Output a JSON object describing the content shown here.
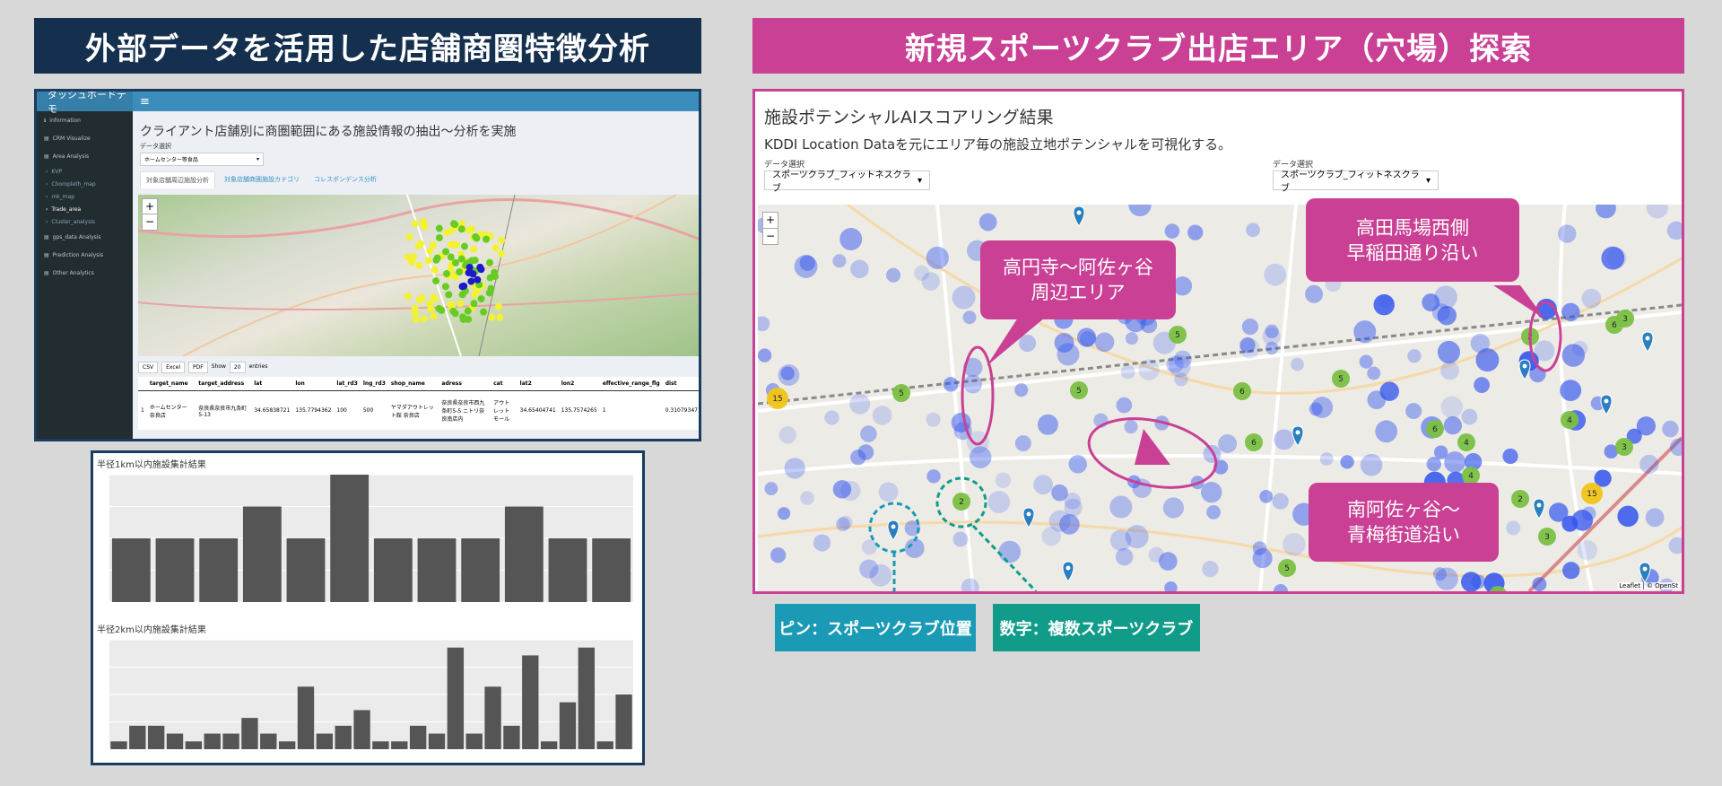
{
  "banners": {
    "left": "外部データを活用した店舗商圏特徴分析",
    "right": "新規スポーツクラブ出店エリア（穴場）探索"
  },
  "dashboard": {
    "brand": "ダッシュボードデモ",
    "menu_icon": "hamburger-icon",
    "sidebar": [
      {
        "label": "information",
        "icon": "info-icon",
        "type": "item"
      },
      {
        "label": "CRM Visualize",
        "icon": "chart-icon",
        "type": "item"
      },
      {
        "label": "Area Analysis",
        "icon": "chart-icon",
        "type": "item"
      },
      {
        "label": "KVP",
        "type": "sub"
      },
      {
        "label": "Choropleth_map",
        "type": "sub"
      },
      {
        "label": "mk_map",
        "type": "sub"
      },
      {
        "label": "Trade_area",
        "type": "sub",
        "active": true
      },
      {
        "label": "Cluster_analysis",
        "type": "sub"
      },
      {
        "label": "gps_data Analysis",
        "icon": "chart-icon",
        "type": "item"
      },
      {
        "label": "Prediction Analysis",
        "icon": "chart-icon",
        "type": "item"
      },
      {
        "label": "Other Analytics",
        "icon": "chart-icon",
        "type": "item"
      }
    ],
    "heading": "クライアント店舗別に商圏範囲にある施設情報の抽出～分析を実施",
    "data_label": "データ選択",
    "select_value": "ホームセンター等食品",
    "tabs": [
      "対象店舗周辺施設分析",
      "対象店舗商圏施設カテゴリ",
      "コレスポンデンス分析"
    ],
    "table_buttons": [
      "CSV",
      "Excel",
      "PDF"
    ],
    "show_label": "Show",
    "show_value": "20",
    "entries_label": "entries",
    "columns": [
      "",
      "target_name",
      "target_address",
      "lat",
      "lon",
      "lat_rd3",
      "lng_rd3",
      "shop_name",
      "adress",
      "cat",
      "lat2",
      "lon2",
      "effective_range_flg",
      "dist"
    ],
    "row": [
      "1",
      "ホームセンター 奈良店",
      "奈良県奈良市九条町5-13",
      "34.65838721",
      "135.7794362",
      "100",
      "500",
      "ヤマダアウトレット館 奈良店",
      "奈良県奈良市西九条町5-5 ニトリ奈良南店内",
      "アウトレットモール",
      "34.65404741",
      "135.7574265",
      "1",
      "0.31079347"
    ]
  },
  "charts": {
    "chart1": {
      "title": "半径1km以内施設集計結果",
      "values": [
        2,
        2,
        2,
        3,
        2,
        4,
        2,
        2,
        2,
        3,
        2,
        2
      ],
      "ylim": [
        0,
        4
      ]
    },
    "chart2": {
      "title": "半径2km以内施設集計結果",
      "values": [
        1,
        3,
        3,
        2,
        1,
        2,
        2,
        4,
        2,
        1,
        8,
        2,
        3,
        5,
        1,
        1,
        3,
        2,
        13,
        2,
        8,
        3,
        12,
        1,
        6,
        13,
        1,
        7
      ],
      "ylim": [
        0,
        14
      ]
    }
  },
  "map_panel": {
    "title": "施設ポテンシャルAIスコアリング結果",
    "subtitle": "KDDI Location Dataを元にエリア毎の施設立地ポテンシャルを可視化する。",
    "select_label_1": "データ選択",
    "select_value_1": "スポーツクラブ_フィットネスクラブ",
    "select_label_2": "データ選択",
    "select_value_2": "スポーツクラブ_フィットネスクラブ",
    "zoom_in": "+",
    "zoom_out": "−",
    "attribution": "Leaflet | © OpenSt",
    "callouts": {
      "koenji": "高円寺～阿佐ヶ谷\n周辺エリア",
      "takadanobaba": "高田馬場西側\n早稲田通り沿い",
      "minamiasagaya": "南阿佐ヶ谷～\n青梅街道沿い"
    },
    "cluster_labels": [
      "5",
      "2",
      "5",
      "5",
      "6",
      "5",
      "6",
      "4",
      "3",
      "2",
      "3",
      "6",
      "4",
      "2",
      "2",
      "15",
      "15",
      "6",
      "3",
      "4",
      "2",
      "5",
      "3"
    ]
  },
  "legends": {
    "pin": "ピン：スポーツクラブ位置",
    "number": "数字：複数スポーツクラブ"
  },
  "colors": {
    "navy": "#15304f",
    "magenta": "#c94094",
    "teal_blue": "#1a9ab5",
    "teal_green": "#119c8a",
    "bar": "#555555",
    "cluster_green": "#7bc043",
    "cluster_yellow": "#f0c419",
    "potential_blue": "#3355ee"
  }
}
